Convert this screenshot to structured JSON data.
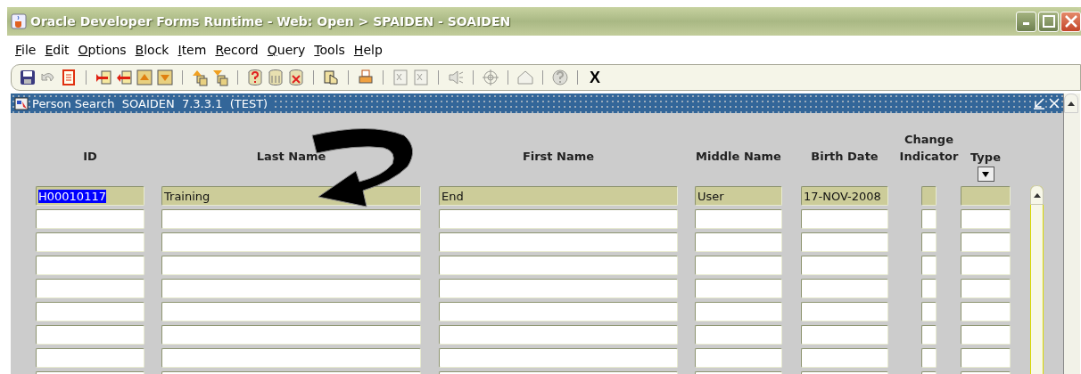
{
  "window": {
    "title": "Oracle Developer Forms Runtime - Web:  Open > SPAIDEN - SOAIDEN"
  },
  "menu": [
    "File",
    "Edit",
    "Options",
    "Block",
    "Item",
    "Record",
    "Query",
    "Tools",
    "Help"
  ],
  "toolbar": [
    {
      "kind": "icon",
      "disabled": false
    },
    {
      "kind": "icon",
      "disabled": true
    },
    {
      "kind": "icon",
      "disabled": false
    },
    {
      "kind": "separator"
    },
    {
      "kind": "icon",
      "disabled": false
    },
    {
      "kind": "icon",
      "disabled": false
    },
    {
      "kind": "icon",
      "disabled": false
    },
    {
      "kind": "icon",
      "disabled": false
    },
    {
      "kind": "separator"
    },
    {
      "kind": "icon",
      "disabled": false
    },
    {
      "kind": "icon",
      "disabled": false
    },
    {
      "kind": "separator"
    },
    {
      "kind": "icon",
      "disabled": false
    },
    {
      "kind": "icon",
      "disabled": false
    },
    {
      "kind": "icon",
      "disabled": false
    },
    {
      "kind": "separator"
    },
    {
      "kind": "icon",
      "disabled": false
    },
    {
      "kind": "separator"
    },
    {
      "kind": "icon",
      "disabled": false
    },
    {
      "kind": "separator"
    },
    {
      "kind": "icon",
      "disabled": true
    },
    {
      "kind": "icon",
      "disabled": true
    },
    {
      "kind": "separator"
    },
    {
      "kind": "icon",
      "disabled": true
    },
    {
      "kind": "separator"
    },
    {
      "kind": "icon",
      "disabled": true
    },
    {
      "kind": "separator"
    },
    {
      "kind": "icon",
      "disabled": true
    },
    {
      "kind": "separator"
    },
    {
      "kind": "icon",
      "disabled": true
    },
    {
      "kind": "separator"
    },
    {
      "kind": "text",
      "label": "X"
    }
  ],
  "form": {
    "title": "Person Search  SOAIDEN  7.3.3.1  (TEST)",
    "columns": [
      "ID",
      "Last Name",
      "First Name",
      "Middle Name",
      "Birth Date",
      "Change Indicator",
      "Type"
    ],
    "rows": [
      {
        "current": true,
        "id": "H00010117",
        "id_selected": true,
        "last_name": "Training",
        "first_name": "End",
        "middle_name": "User",
        "birth_date": "17-NOV-2008"
      },
      {
        "current": false
      },
      {
        "current": false
      },
      {
        "current": false
      },
      {
        "current": false
      },
      {
        "current": false
      },
      {
        "current": false
      },
      {
        "current": false
      },
      {
        "current": false
      }
    ]
  }
}
